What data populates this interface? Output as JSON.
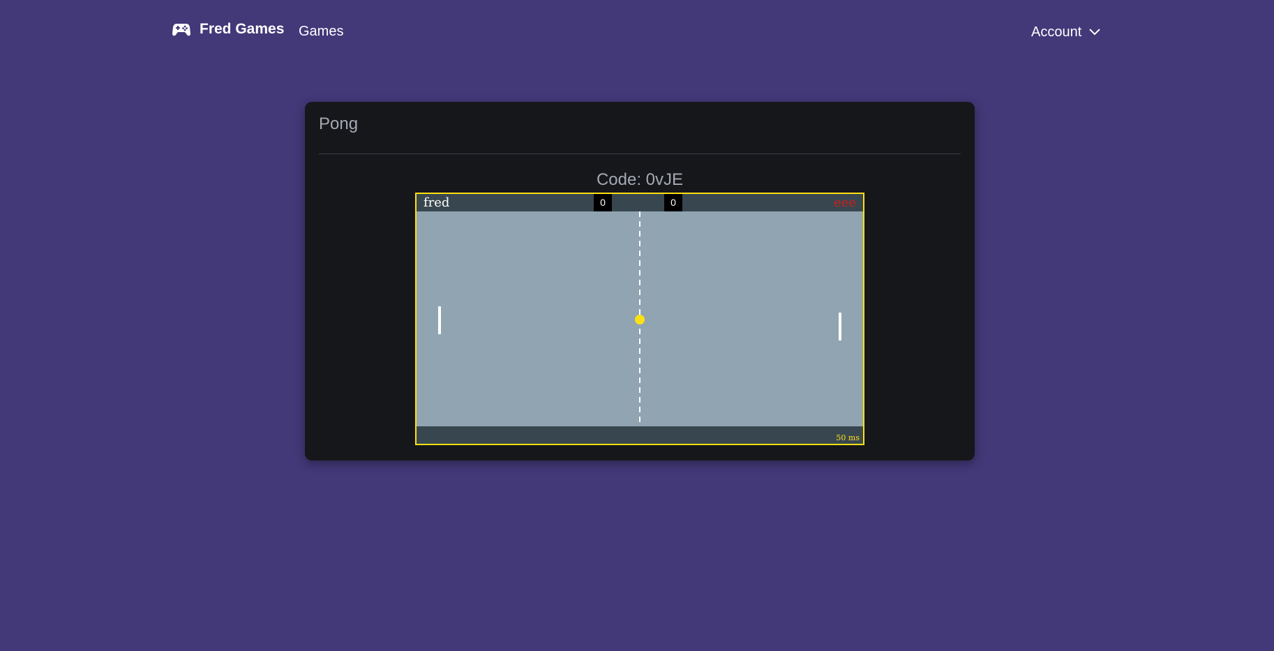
{
  "nav": {
    "brand": "Fred Games",
    "brand_icon": "gamepad-icon",
    "games_link": "Games",
    "account_label": "Account",
    "account_icon": "chevron-down-icon"
  },
  "card": {
    "title": "Pong",
    "code_text": "Code: 0vJE"
  },
  "game": {
    "player_left": "fred",
    "player_right": "eee",
    "score_left": "0",
    "score_right": "0",
    "latency": "50 ms",
    "colors": {
      "border": "#ffe014",
      "field": "#90a4b1",
      "bar": "#38474f",
      "ball": "#ffe014",
      "paddle": "#ffffff",
      "player_right": "#d01c1c"
    }
  }
}
